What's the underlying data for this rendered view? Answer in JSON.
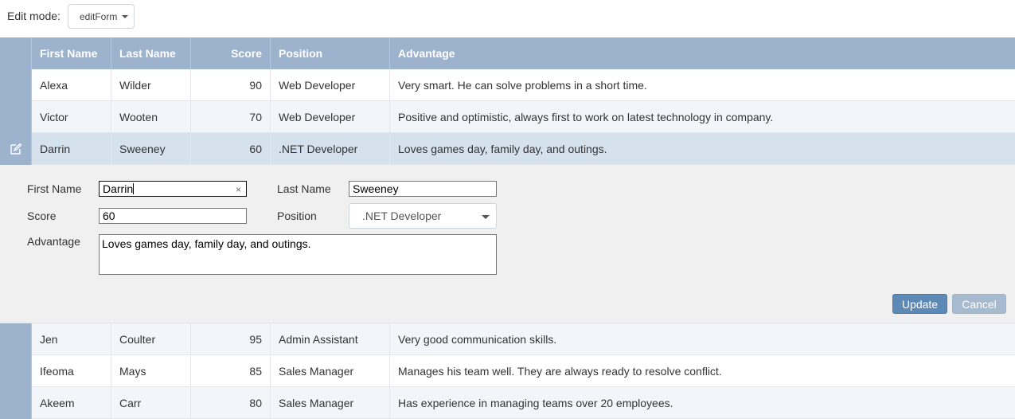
{
  "toolbar": {
    "edit_mode_label": "Edit mode:",
    "edit_mode_value": "editForm"
  },
  "columns": [
    "First Name",
    "Last Name",
    "Score",
    "Position",
    "Advantage"
  ],
  "rows_top": [
    {
      "first": "Alexa",
      "last": "Wilder",
      "score": "90",
      "position": "Web Developer",
      "advantage": "Very smart. He can solve problems in a short time."
    },
    {
      "first": "Victor",
      "last": "Wooten",
      "score": "70",
      "position": "Web Developer",
      "advantage": "Positive and optimistic, always first to work on latest technology in company."
    },
    {
      "first": "Darrin",
      "last": "Sweeney",
      "score": "60",
      "position": ".NET Developer",
      "advantage": "Loves games day, family day, and outings."
    }
  ],
  "edit_form": {
    "first_name_label": "First Name",
    "first_name_value": "Darrin",
    "last_name_label": "Last Name",
    "last_name_value": "Sweeney",
    "score_label": "Score",
    "score_value": "60",
    "position_label": "Position",
    "position_value": ".NET Developer",
    "advantage_label": "Advantage",
    "advantage_value": "Loves games day, family day, and outings.",
    "clear_glyph": "×",
    "update_label": "Update",
    "cancel_label": "Cancel"
  },
  "rows_bottom": [
    {
      "first": "Jen",
      "last": "Coulter",
      "score": "95",
      "position": "Admin Assistant",
      "advantage": "Very good communication skills."
    },
    {
      "first": "Ifeoma",
      "last": "Mays",
      "score": "85",
      "position": "Sales Manager",
      "advantage": "Manages his team well. They are always ready to resolve conflict."
    },
    {
      "first": "Akeem",
      "last": "Carr",
      "score": "80",
      "position": "Sales Manager",
      "advantage": "Has experience in managing teams over 20 employees."
    }
  ],
  "icons": {
    "edit_row": "edit-pencil-icon",
    "dropdown": "chevron-down-icon",
    "clear": "clear-x-icon"
  },
  "colors": {
    "header_bg": "#9db2cd",
    "selected_row_bg": "#d5e1ed",
    "update_button": "#5d89b6",
    "cancel_button": "#a7bbd0",
    "edit_panel_bg": "#f0f0f0"
  }
}
